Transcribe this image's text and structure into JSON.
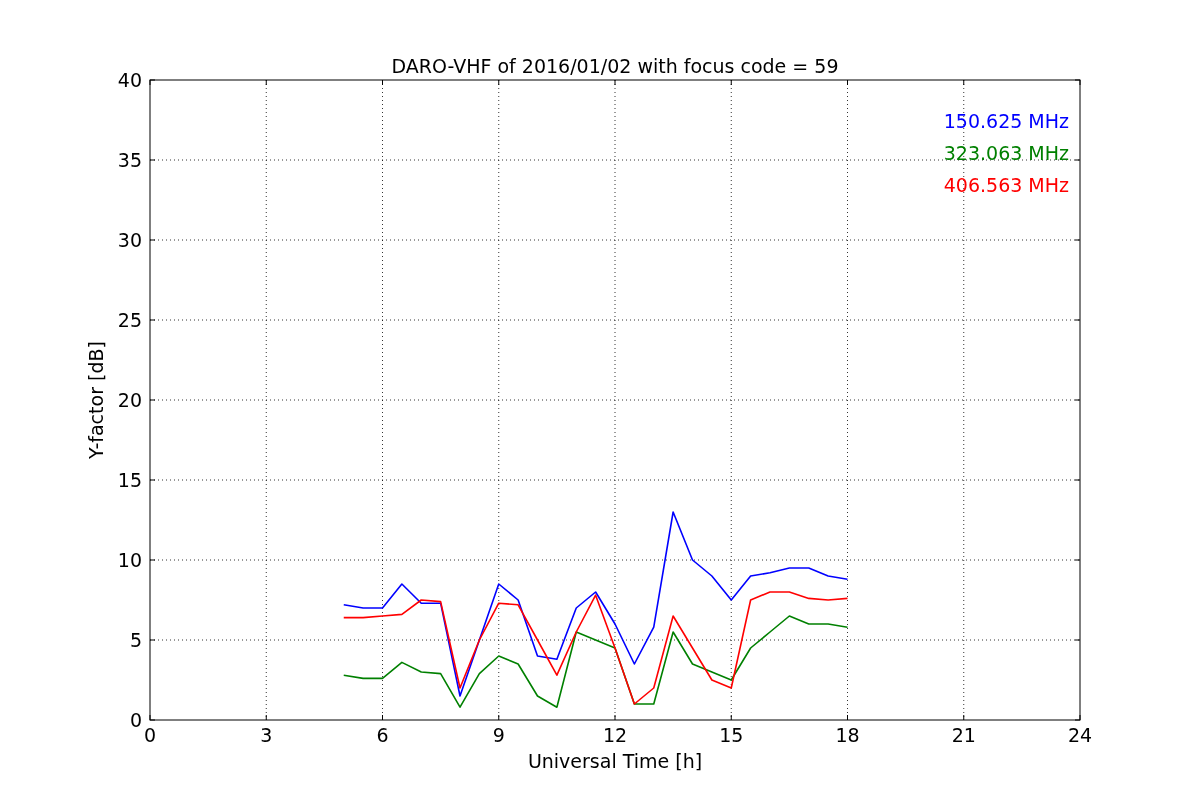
{
  "chart_data": {
    "type": "line",
    "title": "DARO-VHF of 2016/01/02 with focus code = 59",
    "xlabel": "Universal Time [h]",
    "ylabel": "Y-factor [dB]",
    "x": [
      5,
      5.5,
      6,
      6.5,
      7,
      7.5,
      8,
      8.5,
      9,
      9.5,
      10,
      10.5,
      11,
      11.5,
      12,
      12.5,
      13,
      13.5,
      14,
      14.5,
      15,
      15.5,
      16,
      16.5,
      17,
      17.5,
      18
    ],
    "series": [
      {
        "name": "150.625 MHz",
        "color": "#0000ff",
        "values": [
          7.2,
          7.0,
          7.0,
          8.5,
          7.3,
          7.3,
          1.5,
          5.0,
          8.5,
          7.5,
          4.0,
          3.8,
          7.0,
          8.0,
          6.0,
          3.5,
          5.8,
          13.0,
          10.0,
          9.0,
          7.5,
          9.0,
          9.2,
          9.5,
          9.5,
          9.0,
          8.8
        ]
      },
      {
        "name": "323.063 MHz",
        "color": "#008000",
        "values": [
          2.8,
          2.6,
          2.6,
          3.6,
          3.0,
          2.9,
          0.8,
          2.9,
          4.0,
          3.5,
          1.5,
          0.8,
          5.5,
          5.0,
          4.5,
          1.0,
          1.0,
          5.5,
          3.5,
          3.0,
          2.5,
          4.5,
          5.5,
          6.5,
          6.0,
          6.0,
          5.8
        ]
      },
      {
        "name": "406.563 MHz",
        "color": "#ff0000",
        "values": [
          6.4,
          6.4,
          6.5,
          6.6,
          7.5,
          7.4,
          2.0,
          5.0,
          7.3,
          7.2,
          5.0,
          2.8,
          5.5,
          7.8,
          4.5,
          1.0,
          2.0,
          6.5,
          4.5,
          2.5,
          2.0,
          7.5,
          8.0,
          8.0,
          7.6,
          7.5,
          7.6
        ]
      }
    ],
    "grid": true,
    "xlim": [
      0,
      24
    ],
    "ylim": [
      0,
      40
    ],
    "xticks": [
      0,
      3,
      6,
      9,
      12,
      15,
      18,
      21,
      24
    ],
    "yticks": [
      0,
      5,
      10,
      15,
      20,
      25,
      30,
      35,
      40
    ]
  }
}
